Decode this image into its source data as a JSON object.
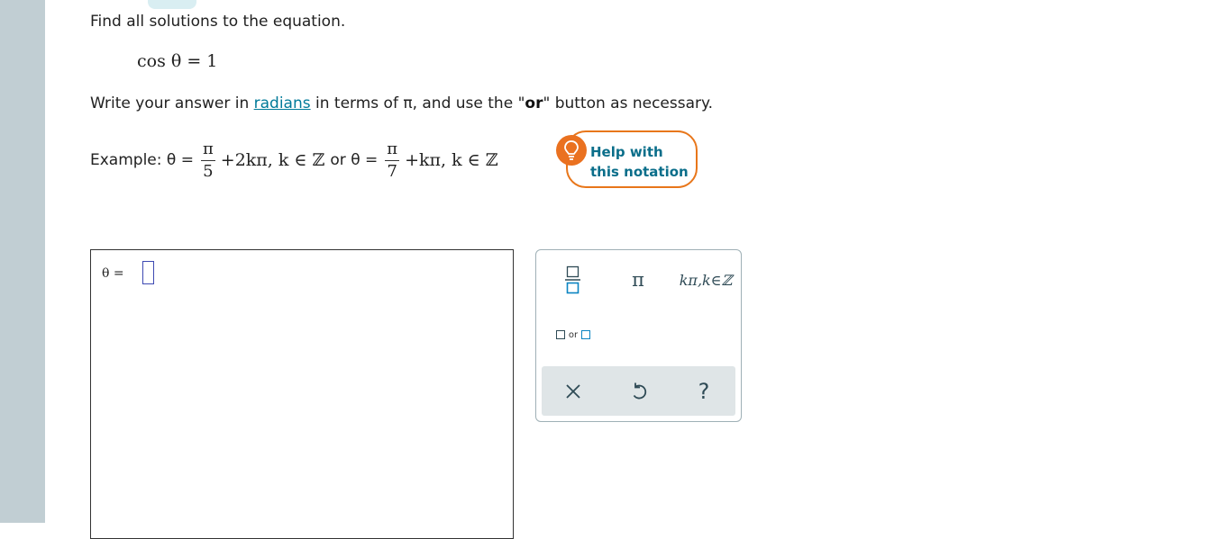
{
  "question": {
    "prompt": "Find all solutions to the equation.",
    "equation": "cos θ = 1",
    "instruction": {
      "before_link": "Write your answer in ",
      "link_text": "radians",
      "middle": " in terms of π, and use the \"",
      "bold_word": "or",
      "after": "\" button as necessary."
    },
    "example": {
      "prefix": "Example: θ = ",
      "frac1_num": "π",
      "frac1_den": "5",
      "term1": "+2kπ, k ∈ ℤ",
      "connector": "or θ =",
      "frac2_num": "π",
      "frac2_den": "7",
      "term2": "+kπ, k ∈ ℤ"
    }
  },
  "help_button": {
    "line1": "Help with",
    "line2": "this notation",
    "icon": "lightbulb-icon",
    "color": "#e8761a"
  },
  "answer": {
    "label": "θ =",
    "value": ""
  },
  "palette": {
    "fraction": "fraction-template",
    "pi": "π",
    "kpi": "kπ,k∈ℤ",
    "or_label": "or",
    "clear": "×",
    "undo": "undo-icon",
    "help": "?"
  },
  "colors": {
    "accent": "#007a99",
    "input_border": "#3d49b2",
    "gutter": "#c1ced3"
  }
}
